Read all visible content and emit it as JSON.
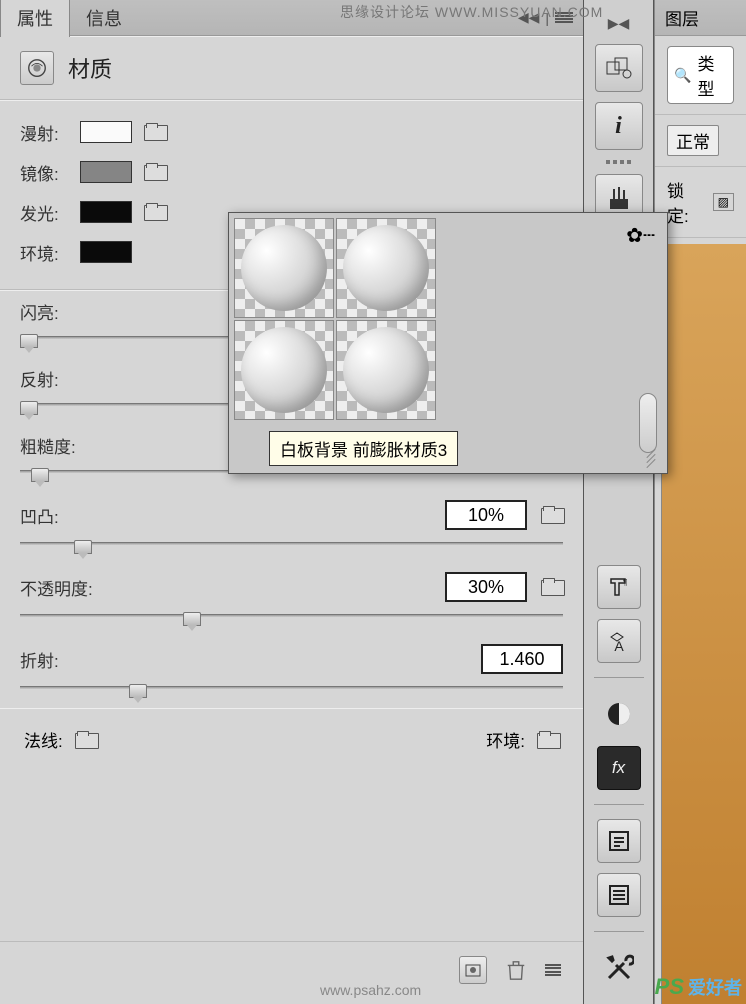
{
  "tabs": {
    "properties": "属性",
    "info": "信息"
  },
  "panel_title": "材质",
  "color_rows": {
    "diffuse_label": "漫射:",
    "mirror_label": "镜像:",
    "glow_label": "发光:",
    "env_label": "环境:"
  },
  "sliders": {
    "shine": "闪亮:",
    "reflect": "反射:",
    "rough": "粗糙度:",
    "bump": "凹凸:",
    "opacity": "不透明度:",
    "refract": "折射:"
  },
  "values": {
    "bump": "10%",
    "opacity": "30%",
    "refract": "1.460"
  },
  "bottom_row": {
    "normal": "法线:",
    "env": "环境:"
  },
  "popout": {
    "tooltip": "白板背景 前膨胀材质3",
    "gear": "✿┄"
  },
  "right_panel": {
    "tab": "图层",
    "search_label": "类型",
    "mode": "正常",
    "lock": "锁定:"
  },
  "watermarks": {
    "top": "思缘设计论坛  WWW.MISSYUAN.COM",
    "bottom": "www.psahz.com",
    "logo": "PS",
    "logo_cn": "爱好者"
  },
  "icons": {
    "search": "🔍",
    "info": "i",
    "brushes": "⚟",
    "threeD": "⧈",
    "textA": "A",
    "circle": "◑",
    "fx": "fx",
    "list1": "☰",
    "list2": "≣",
    "tools": "✕"
  }
}
